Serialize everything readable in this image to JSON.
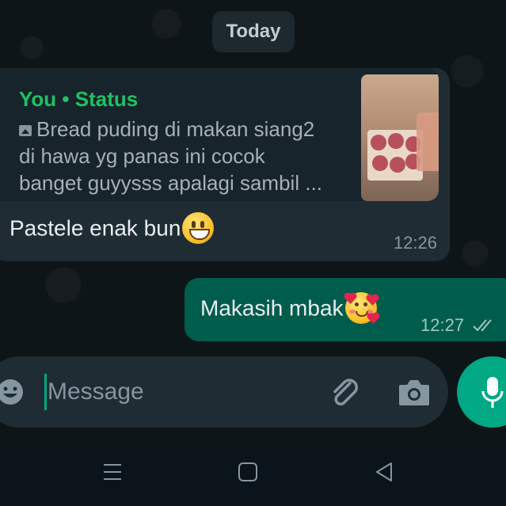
{
  "date_chip": "Today",
  "incoming": {
    "quote": {
      "author": "You",
      "separator": "•",
      "source": "Status",
      "lines": [
        "Bread puding di makan siang2",
        "di hawa yg panas ini cocok",
        "banget guyysss apalagi sambil ..."
      ],
      "thumbnail_icon": "photo-thumbnail"
    },
    "text": "Pastele enak bun",
    "emoji": "grinning-face",
    "time": "12:26"
  },
  "outgoing": {
    "text": "Makasih mbak",
    "emoji": "smiling-face-with-hearts",
    "time": "12:27",
    "status_icon": "double-check-icon"
  },
  "composer": {
    "placeholder": "Message",
    "value": "",
    "icons": [
      "emoji-icon",
      "paperclip-icon",
      "camera-icon",
      "microphone-icon"
    ]
  },
  "nav_icons": [
    "recents-icon",
    "home-icon",
    "back-icon"
  ],
  "colors": {
    "accent": "#00a884",
    "quote_author": "#21c063",
    "outgoing_bubble": "#005c4b",
    "incoming_bubble": "#1f2c34",
    "background": "#0b141a"
  }
}
